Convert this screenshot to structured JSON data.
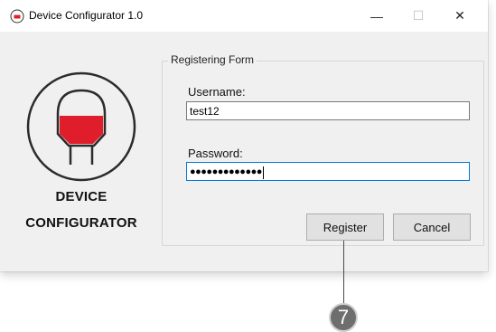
{
  "window": {
    "title": "Device Configurator 1.0",
    "minimize_icon": "minimize-icon",
    "maximize_icon": "maximize-icon",
    "close_icon": "close-icon",
    "minimize_glyph": "—",
    "maximize_glyph": "☐",
    "close_glyph": "✕"
  },
  "logo": {
    "line1": "DEVICE",
    "line2": "CONFIGURATOR",
    "icon": "tank-logo-icon",
    "colors": {
      "fill": "#e01e2b",
      "outline": "#2b2b2b"
    }
  },
  "form": {
    "group_title": "Registering Form",
    "username_label": "Username:",
    "username_value": "test12",
    "password_label": "Password:",
    "password_mask": "●●●●●●●●●●●●●",
    "register_label": "Register",
    "cancel_label": "Cancel"
  },
  "annotation": {
    "step_number": "7"
  },
  "colors": {
    "focus_border": "#0078d7",
    "window_bg": "#f0f0f0"
  }
}
